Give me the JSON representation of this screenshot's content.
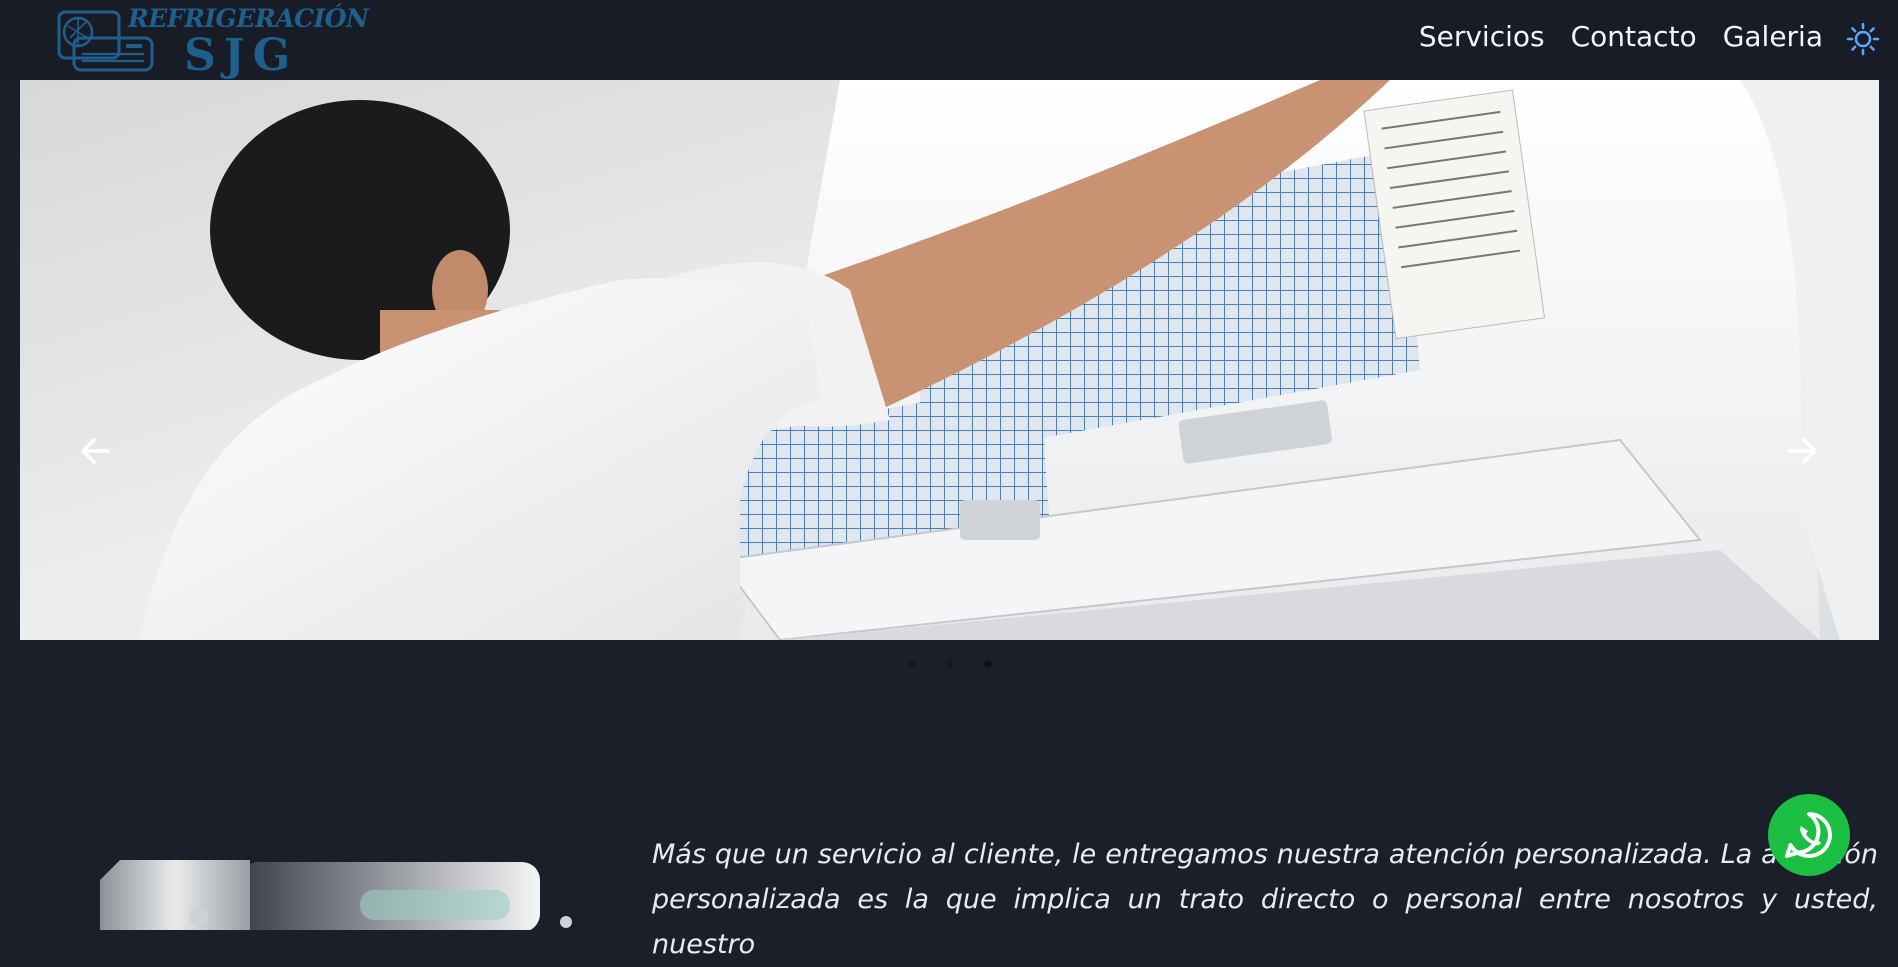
{
  "logo": {
    "line1": "REFRIGERACIÓN",
    "line2": "SJG",
    "icon": "air-conditioner-icon",
    "color": "#1f5f8c"
  },
  "nav": {
    "items": [
      {
        "label": "Servicios"
      },
      {
        "label": "Contacto"
      },
      {
        "label": "Galeria"
      }
    ],
    "theme_icon": "sun-icon",
    "theme_color": "#5aa8ff"
  },
  "carousel": {
    "prev_icon": "arrow-left-icon",
    "next_icon": "arrow-right-icon",
    "slide_count": 3,
    "active_index": 2
  },
  "about": {
    "text": "Más que un servicio al cliente, le entregamos nuestra atención personalizada. La atención personalizada es la que implica un trato directo o personal entre nosotros y usted, nuestro"
  },
  "whatsapp": {
    "icon": "whatsapp-icon",
    "color": "#1bc042"
  },
  "colors": {
    "background": "#1b1f2a",
    "navbar": "#181c27",
    "text": "#f2f4f7"
  }
}
